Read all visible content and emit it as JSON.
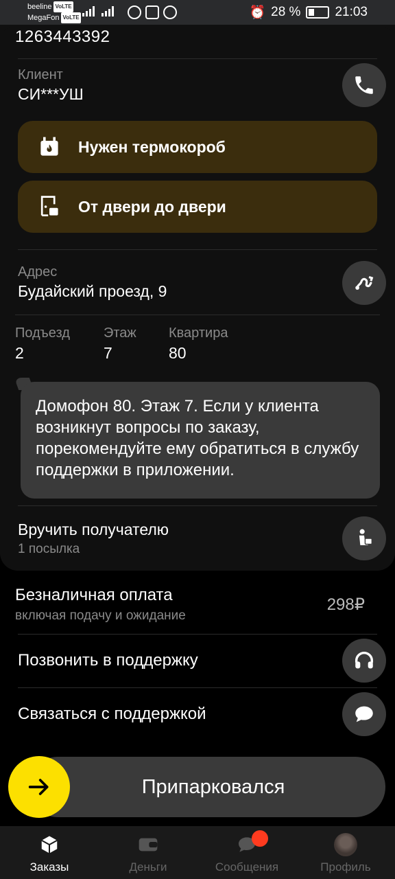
{
  "status_bar": {
    "carrier1": "beeline",
    "carrier2": "MegaFon",
    "volte": "VoLTE",
    "network": "4G",
    "battery": "28 %",
    "time": "21:03"
  },
  "order": {
    "number": "1263443392",
    "client_label": "Клиент",
    "client_name": "СИ***УШ",
    "tags": [
      {
        "label": "Нужен термокороб",
        "icon": "thermo-box-icon"
      },
      {
        "label": "От двери до двери",
        "icon": "door-to-door-icon"
      }
    ],
    "address_label": "Адрес",
    "address": "Будайский проезд, 9",
    "entrance_label": "Подъезд",
    "entrance": "2",
    "floor_label": "Этаж",
    "floor": "7",
    "apartment_label": "Квартира",
    "apartment": "80",
    "comment": "Домофон 80. Этаж 7. Если у клиента возникнут вопросы по заказу, порекомендуйте ему обратиться в службу поддержки в приложении.",
    "handover_title": "Вручить получателю",
    "handover_sub": "1 посылка"
  },
  "payment": {
    "title": "Безналичная оплата",
    "subtitle": "включая подачу и ожидание",
    "amount": "298₽"
  },
  "support": {
    "call": "Позвонить в поддержку",
    "chat": "Связаться с поддержкой"
  },
  "action": {
    "slider_label": "Припарковался"
  },
  "nav": {
    "items": [
      {
        "label": "Заказы",
        "icon": "box-icon",
        "active": true
      },
      {
        "label": "Деньги",
        "icon": "wallet-icon",
        "active": false
      },
      {
        "label": "Сообщения",
        "icon": "chat-icon",
        "active": false
      },
      {
        "label": "Профиль",
        "icon": "avatar",
        "active": false
      }
    ]
  },
  "colors": {
    "accent": "#fce000",
    "tag_bg": "#3b2d0d",
    "badge": "#ff3b1f"
  }
}
